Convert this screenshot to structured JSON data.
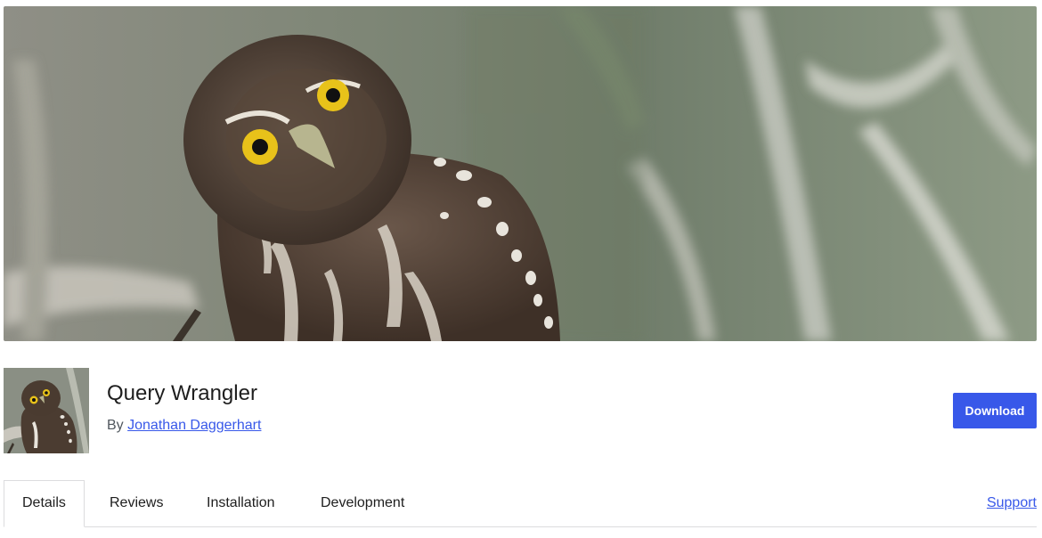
{
  "banner": {
    "image": "owl-photo-banner"
  },
  "plugin": {
    "icon": "owl-photo-icon",
    "title": "Query Wrangler",
    "by_prefix": "By",
    "author": "Jonathan Daggerhart",
    "download_label": "Download"
  },
  "tabs": [
    {
      "label": "Details",
      "active": true
    },
    {
      "label": "Reviews",
      "active": false
    },
    {
      "label": "Installation",
      "active": false
    },
    {
      "label": "Development",
      "active": false
    }
  ],
  "support_label": "Support",
  "colors": {
    "accent": "#3858e9",
    "text": "#1e1e1e",
    "muted": "#50575e",
    "border": "#dcdcde"
  }
}
